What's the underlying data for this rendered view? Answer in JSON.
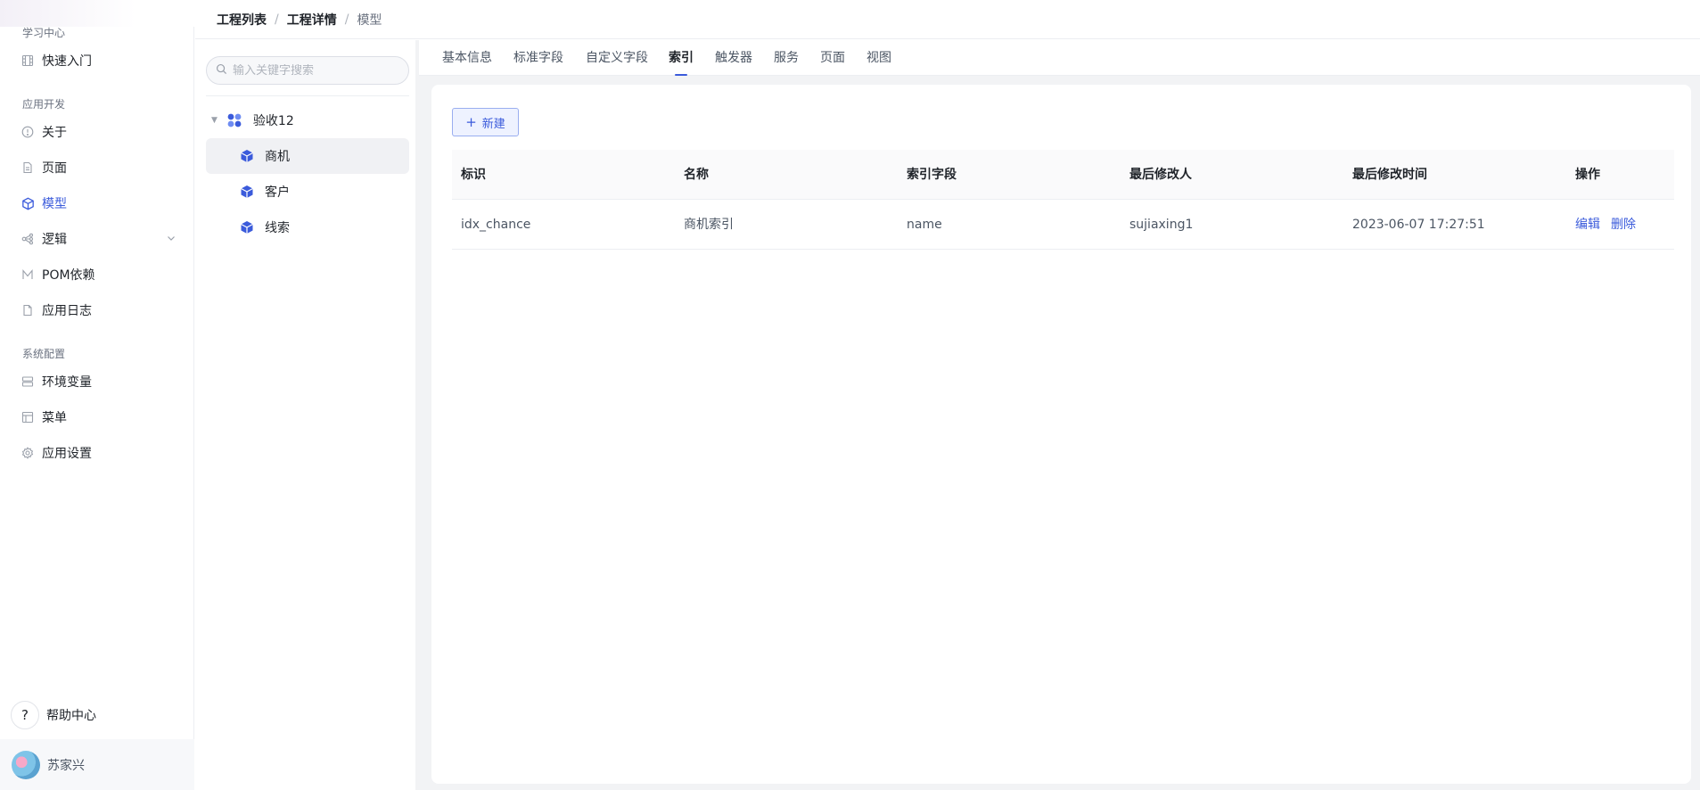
{
  "sidebar": {
    "groups": {
      "learning": "学习中心",
      "app_dev": "应用开发",
      "sys_config": "系统配置"
    },
    "items": {
      "quick_start": "快速入门",
      "about": "关于",
      "page": "页面",
      "model": "模型",
      "logic": "逻辑",
      "pom": "POM依赖",
      "app_log": "应用日志",
      "env_vars": "环境变量",
      "menu": "菜单",
      "app_settings": "应用设置"
    },
    "active_item": "模型",
    "help": "帮助中心",
    "user": "苏家兴"
  },
  "breadcrumb": {
    "items": [
      "工程列表",
      "工程详情",
      "模型"
    ],
    "separator": "/"
  },
  "tree": {
    "search_placeholder": "输入关键字搜索",
    "root": "验收12",
    "children": [
      "商机",
      "客户",
      "线索"
    ],
    "selected": "商机"
  },
  "tabs": {
    "items": [
      "基本信息",
      "标准字段",
      "自定义字段",
      "索引",
      "触发器",
      "服务",
      "页面",
      "视图"
    ],
    "active": "索引"
  },
  "toolbar": {
    "new_label": "新建"
  },
  "table": {
    "headers": [
      "标识",
      "名称",
      "索引字段",
      "最后修改人",
      "最后修改时间",
      "操作"
    ],
    "rows": [
      {
        "id": "idx_chance",
        "name": "商机索引",
        "fields": "name",
        "modifier": "sujiaxing1",
        "modified_at": "2023-06-07 17:27:51"
      }
    ],
    "actions": {
      "edit": "编辑",
      "delete": "删除"
    }
  },
  "colors": {
    "accent": "#3b5bdb",
    "border": "#eceef2",
    "background": "#f2f3f5"
  }
}
